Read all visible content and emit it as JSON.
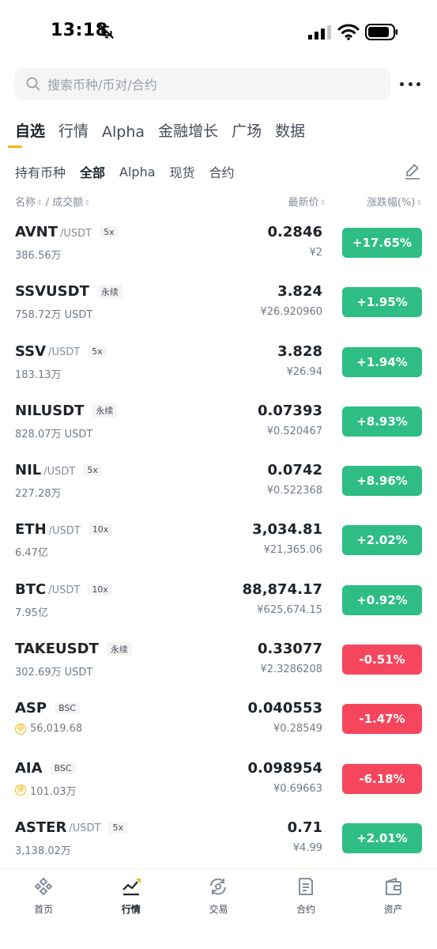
{
  "status_bar": {
    "time": "13:18"
  },
  "search": {
    "placeholder": "搜索币种/币对/合约"
  },
  "main_tabs": [
    {
      "label": "自选",
      "active": true
    },
    {
      "label": "行情"
    },
    {
      "label": "Alpha"
    },
    {
      "label": "金融增长"
    },
    {
      "label": "广场"
    },
    {
      "label": "数据"
    }
  ],
  "sub_tabs": [
    {
      "label": "持有币种"
    },
    {
      "label": "全部",
      "active": true
    },
    {
      "label": "Alpha"
    },
    {
      "label": "现货"
    },
    {
      "label": "合约"
    }
  ],
  "columns": {
    "name": "名称",
    "volume": "/ 成交额",
    "price": "最新价",
    "change": "涨跌幅(%)"
  },
  "rows": [
    {
      "symbol": "AVNT",
      "quote": "/USDT",
      "tag": "5x",
      "volume": "386.56万",
      "price": "0.2846",
      "cny": "¥2",
      "change": "+17.65%",
      "direction": "up"
    },
    {
      "symbol": "SSVUSDT",
      "quote": "",
      "tag": "永续",
      "volume": "758.72万 USDT",
      "price": "3.824",
      "cny": "¥26.920960",
      "change": "+1.95%",
      "direction": "up"
    },
    {
      "symbol": "SSV",
      "quote": "/USDT",
      "tag": "5x",
      "volume": "183.13万",
      "price": "3.828",
      "cny": "¥26.94",
      "change": "+1.94%",
      "direction": "up"
    },
    {
      "symbol": "NILUSDT",
      "quote": "",
      "tag": "永续",
      "volume": "828.07万 USDT",
      "price": "0.07393",
      "cny": "¥0.520467",
      "change": "+8.93%",
      "direction": "up"
    },
    {
      "symbol": "NIL",
      "quote": "/USDT",
      "tag": "5x",
      "volume": "227.28万",
      "price": "0.0742",
      "cny": "¥0.522368",
      "change": "+8.96%",
      "direction": "up"
    },
    {
      "symbol": "ETH",
      "quote": "/USDT",
      "tag": "10x",
      "volume": "6.47亿",
      "price": "3,034.81",
      "cny": "¥21,365.06",
      "change": "+2.02%",
      "direction": "up"
    },
    {
      "symbol": "BTC",
      "quote": "/USDT",
      "tag": "10x",
      "volume": "7.95亿",
      "price": "88,874.17",
      "cny": "¥625,674.15",
      "change": "+0.92%",
      "direction": "up"
    },
    {
      "symbol": "TAKEUSDT",
      "quote": "",
      "tag": "永续",
      "volume": "302.69万 USDT",
      "price": "0.33077",
      "cny": "¥2.3286208",
      "change": "-0.51%",
      "direction": "down"
    },
    {
      "symbol": "ASP",
      "quote": "",
      "tag": "BSC",
      "volume": "56,019.68",
      "vol_icon": "alpha-coin-icon",
      "price": "0.040553",
      "cny": "¥0.28549",
      "change": "-1.47%",
      "direction": "down"
    },
    {
      "symbol": "AIA",
      "quote": "",
      "tag": "BSC",
      "volume": "101.03万",
      "vol_icon": "alpha-coin-icon",
      "price": "0.098954",
      "cny": "¥0.69663",
      "change": "-6.18%",
      "direction": "down"
    },
    {
      "symbol": "ASTER",
      "quote": "/USDT",
      "tag": "5x",
      "volume": "3,138.02万",
      "price": "0.71",
      "cny": "¥4.99",
      "change": "+2.01%",
      "direction": "up"
    }
  ],
  "bottom_nav": [
    {
      "label": "首页",
      "icon": "home-icon"
    },
    {
      "label": "行情",
      "icon": "markets-icon",
      "active": true
    },
    {
      "label": "交易",
      "icon": "trade-icon"
    },
    {
      "label": "合约",
      "icon": "futures-icon"
    },
    {
      "label": "资产",
      "icon": "wallet-icon"
    }
  ],
  "colors": {
    "up": "#2ebd85",
    "down": "#f6465d",
    "accent": "#f0b90b"
  }
}
